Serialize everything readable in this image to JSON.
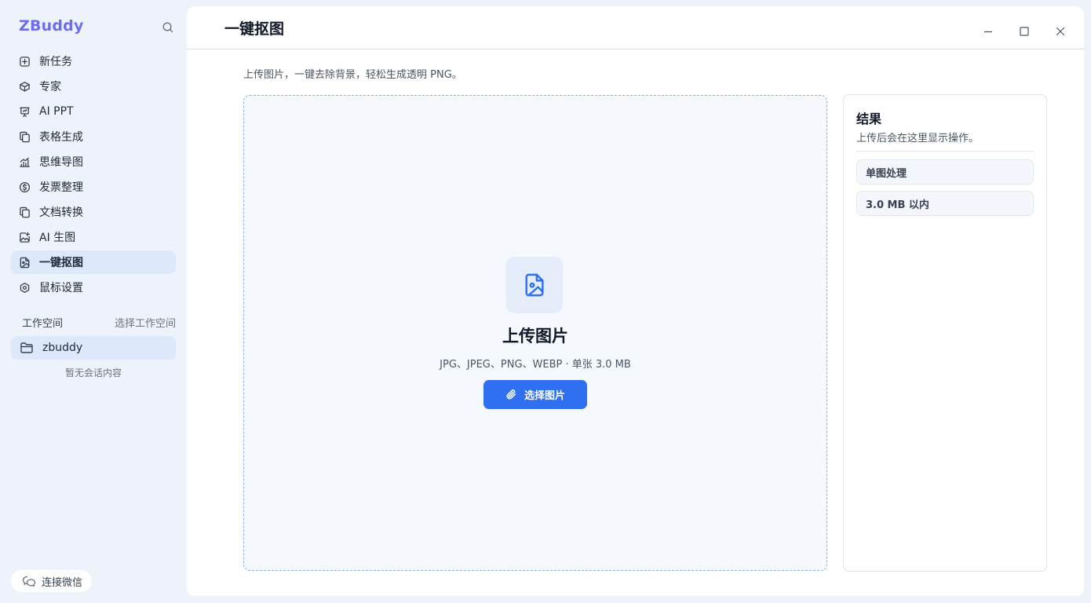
{
  "app": {
    "brand": "ZBuddy"
  },
  "sidebar": {
    "items": [
      {
        "label": "新任务",
        "icon": "plus-square-icon"
      },
      {
        "label": "专家",
        "icon": "box-icon"
      },
      {
        "label": "AI PPT",
        "icon": "presentation-icon"
      },
      {
        "label": "表格生成",
        "icon": "copy-icon"
      },
      {
        "label": "思维导图",
        "icon": "bar-chart-icon"
      },
      {
        "label": "发票整理",
        "icon": "dollar-circle-icon"
      },
      {
        "label": "文档转换",
        "icon": "copy-icon"
      },
      {
        "label": "AI 生图",
        "icon": "image-plus-icon"
      },
      {
        "label": "一键抠图",
        "icon": "image-file-icon",
        "active": true
      },
      {
        "label": "鼠标设置",
        "icon": "hexagon-settings-icon"
      }
    ],
    "workspace_label": "工作空间",
    "workspace_select": "选择工作空间",
    "workspace_item": "zbuddy",
    "empty_text": "暂无会话内容",
    "wechat_button": "连接微信"
  },
  "main": {
    "title": "一键抠图",
    "subtitle": "上传图片，一键去除背景，轻松生成透明 PNG。",
    "upload": {
      "title": "上传图片",
      "hint": "JPG、JPEG、PNG、WEBP · 单张 3.0 MB",
      "button": "选择图片"
    },
    "result": {
      "title": "结果",
      "desc": "上传后会在这里显示操作。",
      "tags": [
        "单图处理",
        "3.0 MB 以内"
      ]
    }
  },
  "colors": {
    "brand": "#6b6cf0",
    "accent": "#2f6ff0",
    "active_bg": "#dde8fb",
    "app_bg": "#eef3fb"
  }
}
